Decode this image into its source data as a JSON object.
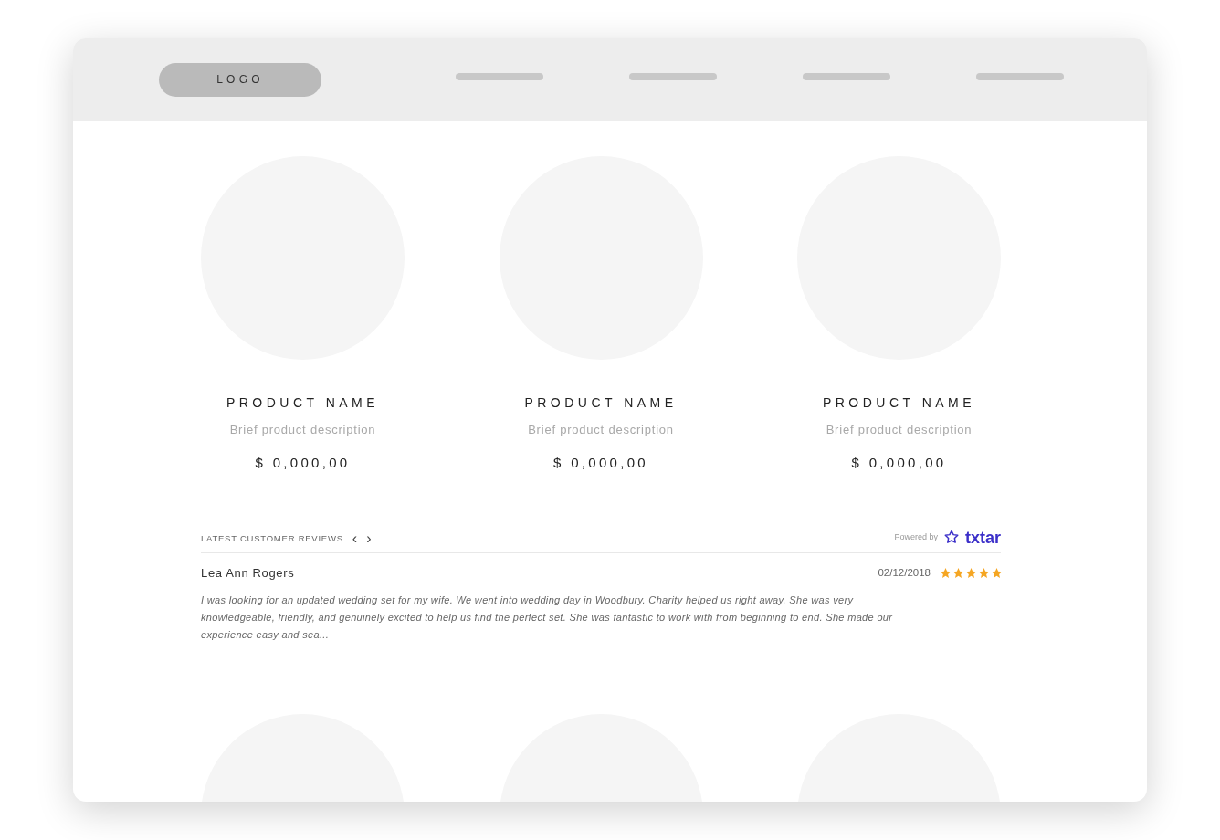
{
  "header": {
    "logo": "LOGO"
  },
  "products": [
    {
      "name": "PRODUCT NAME",
      "description": "Brief product description",
      "price": "$ 0,000,00"
    },
    {
      "name": "PRODUCT NAME",
      "description": "Brief product description",
      "price": "$ 0,000,00"
    },
    {
      "name": "PRODUCT NAME",
      "description": "Brief product description",
      "price": "$ 0,000,00"
    }
  ],
  "reviews": {
    "title": "LATEST CUSTOMER REVIEWS",
    "prev": "‹",
    "next": "›",
    "powered_by": "Powered by",
    "brand": "txtar",
    "items": [
      {
        "author": "Lea Ann Rogers",
        "date": "02/12/2018",
        "stars": 5,
        "text": "I was looking for an updated wedding set for my wife. We went into wedding day in Woodbury. Charity helped us right away. She was very knowledgeable, friendly, and genuinely excited to help us find the perfect set. She was fantastic to work with from beginning to end. She made our experience easy and sea..."
      }
    ]
  },
  "more_products": [
    {
      "kind": "placeholder"
    },
    {
      "kind": "placeholder"
    },
    {
      "kind": "placeholder"
    }
  ]
}
